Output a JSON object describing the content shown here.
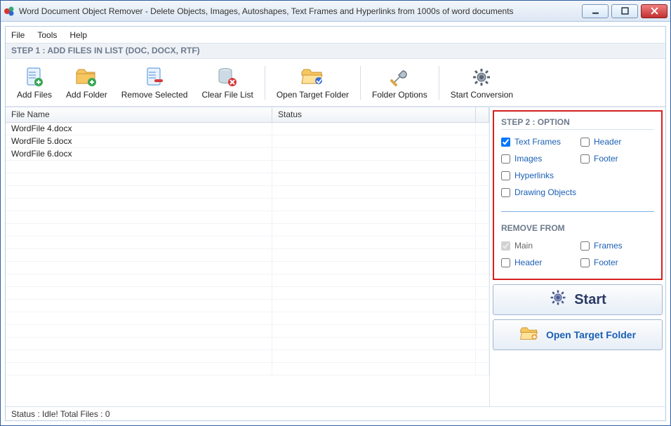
{
  "window": {
    "title": "Word Document Object Remover - Delete Objects, Images, Autoshapes, Text Frames and Hyperlinks from 1000s of word documents"
  },
  "menu": {
    "file": "File",
    "tools": "Tools",
    "help": "Help"
  },
  "step1_label": "STEP 1 : ADD FILES IN LIST (DOC, DOCX, RTF)",
  "toolbar": {
    "add_files": "Add Files",
    "add_folder": "Add Folder",
    "remove_selected": "Remove Selected",
    "clear_file_list": "Clear File List",
    "open_target_folder": "Open Target Folder",
    "folder_options": "Folder Options",
    "start_conversion": "Start Conversion"
  },
  "columns": {
    "file_name": "File Name",
    "status": "Status"
  },
  "files": [
    {
      "name": "WordFile 4.docx",
      "status": ""
    },
    {
      "name": "WordFile 5.docx",
      "status": ""
    },
    {
      "name": "WordFile 6.docx",
      "status": ""
    }
  ],
  "step2_label": "STEP 2 : OPTION",
  "options": {
    "text_frames": {
      "label": "Text Frames",
      "checked": true
    },
    "header": {
      "label": "Header",
      "checked": false
    },
    "images": {
      "label": "Images",
      "checked": false
    },
    "footer": {
      "label": "Footer",
      "checked": false
    },
    "hyperlinks": {
      "label": "Hyperlinks",
      "checked": false
    },
    "drawing_objects": {
      "label": "Drawing Objects",
      "checked": false
    }
  },
  "remove_from_label": "REMOVE FROM",
  "remove_from": {
    "main": {
      "label": "Main",
      "checked": true,
      "disabled": true
    },
    "frames": {
      "label": "Frames",
      "checked": false
    },
    "header": {
      "label": "Header",
      "checked": false
    },
    "footer": {
      "label": "Footer",
      "checked": false
    }
  },
  "buttons": {
    "start": "Start",
    "open_target": "Open Target Folder"
  },
  "statusbar": "Status  :  Idle!  Total Files : 0"
}
